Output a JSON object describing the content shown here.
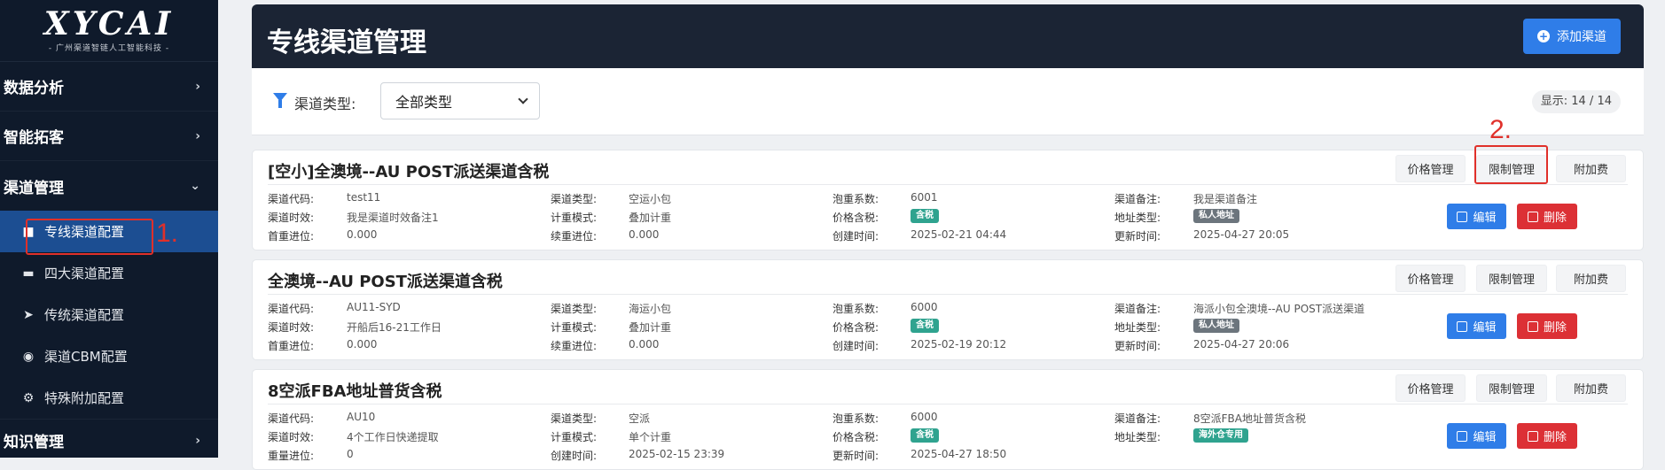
{
  "sidebar": {
    "logo_text": "XYCAI",
    "logo_sub": "- 广州渠道智链人工智能科技 -",
    "groups": [
      {
        "label": "数据分析",
        "chev": "›"
      },
      {
        "label": "智能拓客",
        "chev": "›"
      },
      {
        "label": "渠道管理",
        "chev": "⌄"
      }
    ],
    "sub_items": [
      {
        "label": "专线渠道配置",
        "icon": "truck-icon"
      },
      {
        "label": "四大渠道配置",
        "icon": "truck-fast-icon"
      },
      {
        "label": "传统渠道配置",
        "icon": "plane-icon"
      },
      {
        "label": "渠道CBM配置",
        "icon": "box-icon"
      },
      {
        "label": "特殊附加配置",
        "icon": "gear-icon"
      }
    ],
    "bottom_group": {
      "label": "知识管理",
      "chev": "›"
    }
  },
  "annotations": {
    "one": "1.",
    "two": "2."
  },
  "header": {
    "title": "专线渠道管理",
    "add_button": "添加渠道"
  },
  "filter": {
    "label": "渠道类型:",
    "selected": "全部类型",
    "count": "显示: 14 / 14"
  },
  "labels": {
    "code": "渠道代码:",
    "type": "渠道类型:",
    "coef": "泡重系数:",
    "remark": "渠道备注:",
    "time": "渠道时效:",
    "mode": "计重模式:",
    "tax": "价格含税:",
    "addr": "地址类型:",
    "first": "首重进位:",
    "cont": "续重进位:",
    "created": "创建时间:",
    "updated": "更新时间:",
    "weight": "重量进位:",
    "price_mgmt": "价格管理",
    "limit_mgmt": "限制管理",
    "extra_fee": "附加费",
    "edit": "编辑",
    "delete": "删除"
  },
  "cards": [
    {
      "title": "[空小]全澳境--AU POST派送渠道含税",
      "code": "test11",
      "type": "空运小包",
      "coef": "6001",
      "remark": "我是渠道备注",
      "time": "我是渠道时效备注1",
      "mode": "叠加计重",
      "tax": "含税",
      "addr": "私人地址",
      "first": "0.000",
      "cont": "0.000",
      "created": "2025-02-21 04:44",
      "updated": "2025-04-27 20:05"
    },
    {
      "title": "全澳境--AU POST派送渠道含税",
      "code": "AU11-SYD",
      "type": "海运小包",
      "coef": "6000",
      "remark": "海派小包全澳境--AU POST派送渠道",
      "time": "开船后16-21工作日",
      "mode": "叠加计重",
      "tax": "含税",
      "addr": "私人地址",
      "first": "0.000",
      "cont": "0.000",
      "created": "2025-02-19 20:12",
      "updated": "2025-04-27 20:06"
    },
    {
      "title": "8空派FBA地址普货含税",
      "code": "AU10",
      "type": "空派",
      "coef": "6000",
      "remark": "8空派FBA地址普货含税",
      "time": "4个工作日快递提取",
      "mode": "单个计重",
      "tax": "含税",
      "addr": "海外仓专用",
      "weight": "0",
      "created": "2025-02-15 23:39",
      "updated": "2025-04-27 18:50"
    }
  ],
  "colors": {
    "accent": "#2f7de8",
    "danger": "#dc3035",
    "badge_green": "#2fa38f",
    "badge_gray": "#6c757d",
    "annotation": "#e0302a"
  }
}
